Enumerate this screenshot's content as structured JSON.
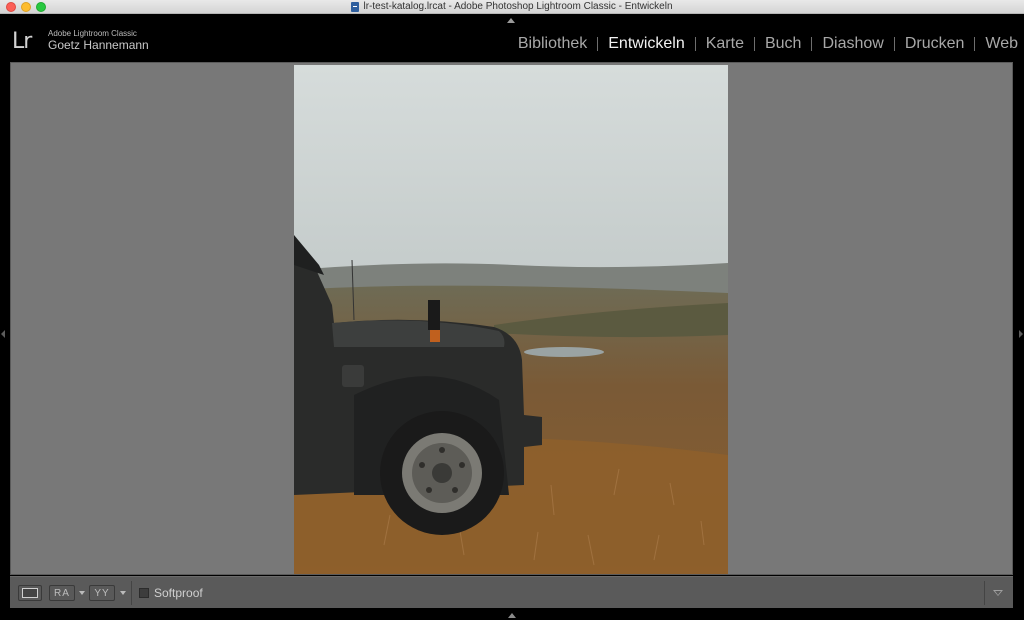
{
  "window": {
    "title": "lr-test-katalog.lrcat - Adobe Photoshop Lightroom Classic - Entwickeln"
  },
  "identity": {
    "logo": "Lr",
    "product": "Adobe Lightroom Classic",
    "user": "Goetz Hannemann"
  },
  "modules": {
    "items": [
      {
        "label": "Bibliothek",
        "active": false
      },
      {
        "label": "Entwickeln",
        "active": true
      },
      {
        "label": "Karte",
        "active": false
      },
      {
        "label": "Buch",
        "active": false
      },
      {
        "label": "Diashow",
        "active": false
      },
      {
        "label": "Drucken",
        "active": false
      },
      {
        "label": "Web",
        "active": false
      }
    ]
  },
  "toolbar": {
    "ra_label": "RA",
    "yy_label": "YY",
    "softproof_label": "Softproof",
    "softproof_checked": false
  },
  "colors": {
    "active_module": "#f2f2f2",
    "inactive_module": "#a8a8a8",
    "canvas_bg": "#787878",
    "toolbar_bg": "#5a5a5a"
  },
  "icons": {
    "close": "close-button-icon",
    "minimize": "minimize-button-icon",
    "maximize": "maximize-button-icon",
    "document": "document-icon",
    "loupe": "loupe-view-icon",
    "dropdown": "chevron-down-icon",
    "toolbar_menu": "triangle-down-icon"
  }
}
